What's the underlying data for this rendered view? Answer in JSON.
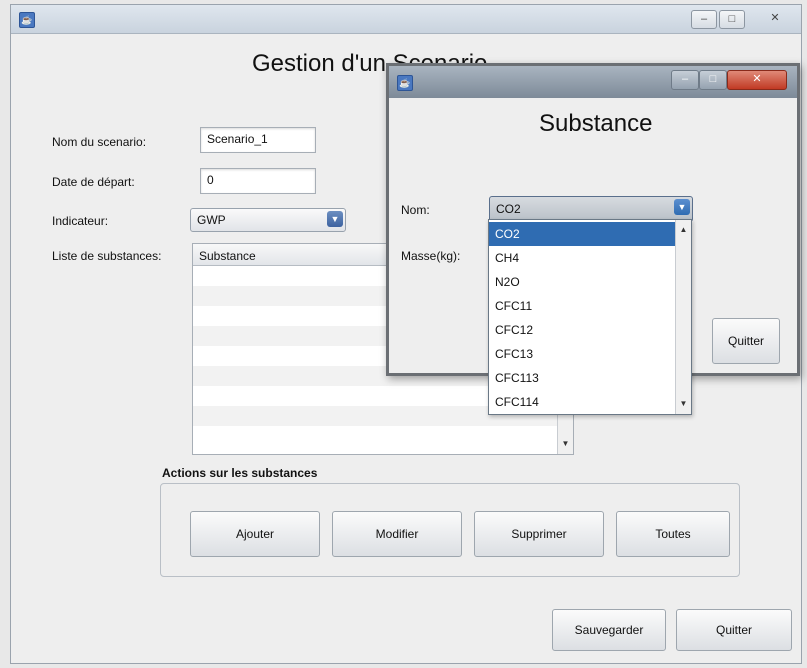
{
  "main": {
    "title": "Gestion d'un Scenario",
    "window_controls": {
      "minimize": "–",
      "maximize": "□",
      "close": "✕"
    },
    "fields": {
      "scenario_name": {
        "label": "Nom du scenario:",
        "value": "Scenario_1"
      },
      "start_date": {
        "label": "Date de départ:",
        "value": "0"
      },
      "indicator": {
        "label": "Indicateur:",
        "value": "GWP"
      },
      "substances_list": {
        "label": "Liste de substances:",
        "column_header": "Substance"
      }
    },
    "actions": {
      "title": "Actions sur les substances",
      "buttons": {
        "add": "Ajouter",
        "modify": "Modifier",
        "delete": "Supprimer",
        "all": "Toutes"
      }
    },
    "footer": {
      "save": "Sauvegarder",
      "quit": "Quitter"
    }
  },
  "dialog": {
    "title": "Substance",
    "window_controls": {
      "minimize": "–",
      "maximize": "□",
      "close": "✕"
    },
    "name_label": "Nom:",
    "mass_label": "Masse(kg):",
    "selected": "CO2",
    "options": [
      "CO2",
      "CH4",
      "N2O",
      "CFC11",
      "CFC12",
      "CFC13",
      "CFC113",
      "CFC114"
    ],
    "quit": "Quitter"
  },
  "colors": {
    "selection": "#2f6cb2",
    "combo_arrow": "#3d62a0",
    "titlebar": "#c9d3de"
  },
  "icons": {
    "app": "java-cup-icon",
    "dropdown": "chevron-down-icon"
  }
}
